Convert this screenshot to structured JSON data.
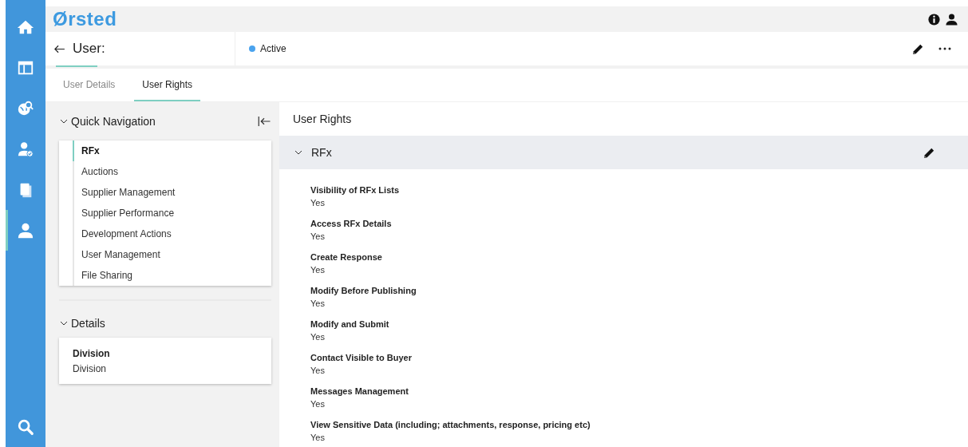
{
  "rail": {
    "items": [
      {
        "kind": "home",
        "selected": false
      },
      {
        "kind": "layout",
        "selected": false
      },
      {
        "kind": "globe",
        "selected": false
      },
      {
        "kind": "usercheck",
        "selected": false
      },
      {
        "kind": "docs",
        "selected": false
      },
      {
        "kind": "user",
        "selected": true
      }
    ],
    "bottom": {
      "kind": "search"
    }
  },
  "header": {
    "logo": "Ørsted"
  },
  "title_bar": {
    "title": "User:",
    "status": "Active"
  },
  "tabs": [
    {
      "label": "User Details",
      "selected": false
    },
    {
      "label": "User Rights",
      "selected": true
    }
  ],
  "quick_navigation": {
    "title": "Quick Navigation",
    "expanded": true,
    "items": [
      {
        "label": "RFx",
        "selected": true
      },
      {
        "label": "Auctions",
        "selected": false
      },
      {
        "label": "Supplier Management",
        "selected": false
      },
      {
        "label": "Supplier Performance",
        "selected": false
      },
      {
        "label": "Development Actions",
        "selected": false
      },
      {
        "label": "User Management",
        "selected": false
      },
      {
        "label": "File Sharing",
        "selected": false
      }
    ]
  },
  "details": {
    "title": "Details",
    "expanded": true,
    "fields": [
      {
        "label": "Division",
        "value": "Division"
      }
    ]
  },
  "user_rights": {
    "title": "User Rights",
    "section": {
      "title": "RFx",
      "expanded": true,
      "rights": [
        {
          "label": "Visibility of RFx Lists",
          "value": "Yes"
        },
        {
          "label": "Access RFx Details",
          "value": "Yes"
        },
        {
          "label": "Create Response",
          "value": "Yes"
        },
        {
          "label": "Modify Before Publishing",
          "value": "Yes"
        },
        {
          "label": "Modify and Submit",
          "value": "Yes"
        },
        {
          "label": "Contact Visible to Buyer",
          "value": "Yes"
        },
        {
          "label": "Messages Management",
          "value": "Yes"
        },
        {
          "label": "View Sensitive Data (including; attachments, response, pricing etc)",
          "value": "Yes"
        }
      ]
    }
  }
}
